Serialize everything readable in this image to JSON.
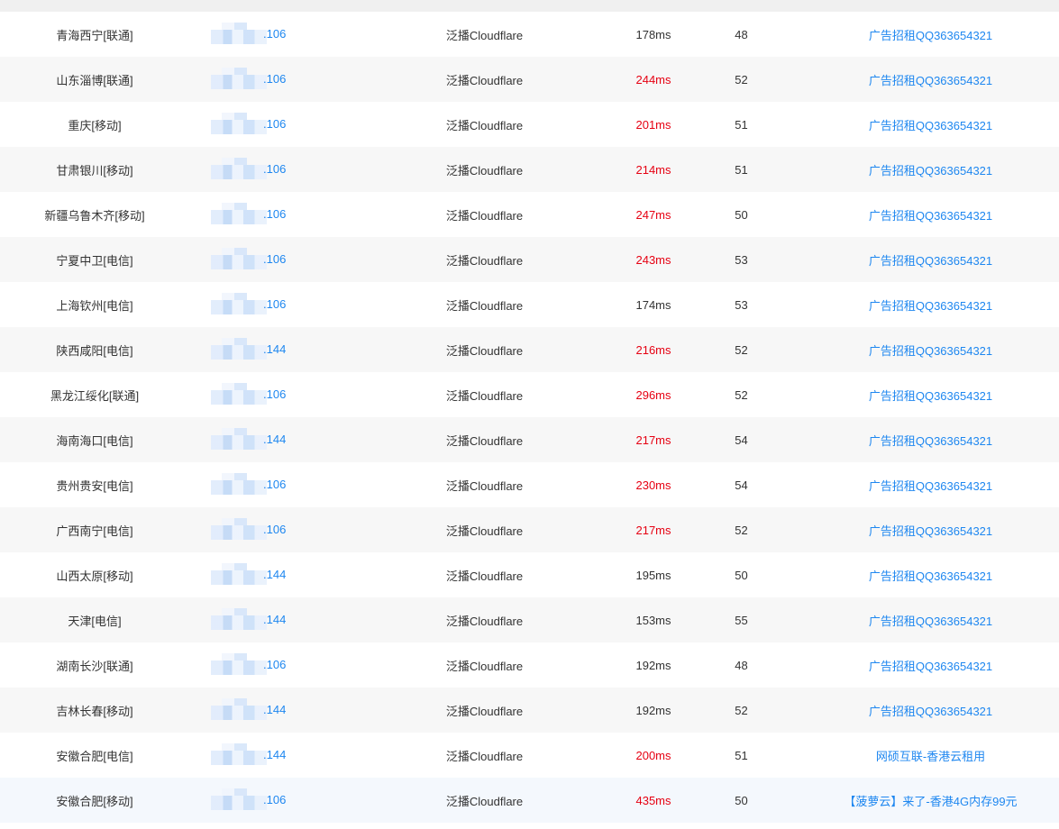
{
  "colors": {
    "link": "#1e87f0",
    "slow": "#e60012",
    "normal": "#333333"
  },
  "rows": [
    {
      "location": "青海西宁[联通]",
      "ip_suffix": ".106",
      "line": "泛播Cloudflare",
      "time": "178ms",
      "slow": false,
      "count": "48",
      "ad": "广告招租QQ363654321"
    },
    {
      "location": "山东淄博[联通]",
      "ip_suffix": ".106",
      "line": "泛播Cloudflare",
      "time": "244ms",
      "slow": true,
      "count": "52",
      "ad": "广告招租QQ363654321"
    },
    {
      "location": "重庆[移动]",
      "ip_suffix": ".106",
      "line": "泛播Cloudflare",
      "time": "201ms",
      "slow": true,
      "count": "51",
      "ad": "广告招租QQ363654321"
    },
    {
      "location": "甘肃银川[移动]",
      "ip_suffix": ".106",
      "line": "泛播Cloudflare",
      "time": "214ms",
      "slow": true,
      "count": "51",
      "ad": "广告招租QQ363654321"
    },
    {
      "location": "新疆乌鲁木齐[移动]",
      "ip_suffix": ".106",
      "line": "泛播Cloudflare",
      "time": "247ms",
      "slow": true,
      "count": "50",
      "ad": "广告招租QQ363654321"
    },
    {
      "location": "宁夏中卫[电信]",
      "ip_suffix": ".106",
      "line": "泛播Cloudflare",
      "time": "243ms",
      "slow": true,
      "count": "53",
      "ad": "广告招租QQ363654321"
    },
    {
      "location": "上海钦州[电信]",
      "ip_suffix": ".106",
      "line": "泛播Cloudflare",
      "time": "174ms",
      "slow": false,
      "count": "53",
      "ad": "广告招租QQ363654321"
    },
    {
      "location": "陕西咸阳[电信]",
      "ip_suffix": ".144",
      "line": "泛播Cloudflare",
      "time": "216ms",
      "slow": true,
      "count": "52",
      "ad": "广告招租QQ363654321"
    },
    {
      "location": "黑龙江绥化[联通]",
      "ip_suffix": ".106",
      "line": "泛播Cloudflare",
      "time": "296ms",
      "slow": true,
      "count": "52",
      "ad": "广告招租QQ363654321"
    },
    {
      "location": "海南海口[电信]",
      "ip_suffix": ".144",
      "line": "泛播Cloudflare",
      "time": "217ms",
      "slow": true,
      "count": "54",
      "ad": "广告招租QQ363654321"
    },
    {
      "location": "贵州贵安[电信]",
      "ip_suffix": ".106",
      "line": "泛播Cloudflare",
      "time": "230ms",
      "slow": true,
      "count": "54",
      "ad": "广告招租QQ363654321"
    },
    {
      "location": "广西南宁[电信]",
      "ip_suffix": ".106",
      "line": "泛播Cloudflare",
      "time": "217ms",
      "slow": true,
      "count": "52",
      "ad": "广告招租QQ363654321"
    },
    {
      "location": "山西太原[移动]",
      "ip_suffix": ".144",
      "line": "泛播Cloudflare",
      "time": "195ms",
      "slow": false,
      "count": "50",
      "ad": "广告招租QQ363654321"
    },
    {
      "location": "天津[电信]",
      "ip_suffix": ".144",
      "line": "泛播Cloudflare",
      "time": "153ms",
      "slow": false,
      "count": "55",
      "ad": "广告招租QQ363654321"
    },
    {
      "location": "湖南长沙[联通]",
      "ip_suffix": ".106",
      "line": "泛播Cloudflare",
      "time": "192ms",
      "slow": false,
      "count": "48",
      "ad": "广告招租QQ363654321"
    },
    {
      "location": "吉林长春[移动]",
      "ip_suffix": ".144",
      "line": "泛播Cloudflare",
      "time": "192ms",
      "slow": false,
      "count": "52",
      "ad": "广告招租QQ363654321"
    },
    {
      "location": "安徽合肥[电信]",
      "ip_suffix": ".144",
      "line": "泛播Cloudflare",
      "time": "200ms",
      "slow": true,
      "count": "51",
      "ad": "网硕互联-香港云租用"
    },
    {
      "location": "安徽合肥[移动]",
      "ip_suffix": ".106",
      "line": "泛播Cloudflare",
      "time": "435ms",
      "slow": true,
      "count": "50",
      "ad": "【菠萝云】来了-香港4G内存99元"
    }
  ]
}
